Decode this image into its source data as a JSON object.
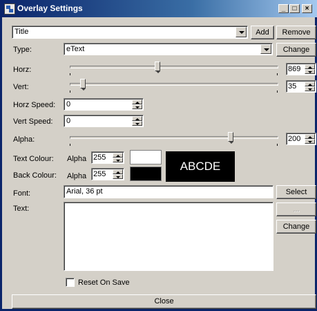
{
  "window": {
    "title": "Overlay Settings"
  },
  "titlebar_buttons": {
    "minimize": "_",
    "maximize": "□",
    "close": "×"
  },
  "overlay_select": {
    "value": "Title"
  },
  "buttons": {
    "add": "Add",
    "remove": "Remove",
    "change_type": "Change",
    "select_font": "Select",
    "browse": "...",
    "change_text": "Change",
    "close": "Close"
  },
  "type": {
    "label": "Type:",
    "value": "eText"
  },
  "horz": {
    "label": "Horz:",
    "value": "869",
    "level_fraction": 0.42
  },
  "vert": {
    "label": "Vert:",
    "value": "35",
    "level_fraction": 0.05
  },
  "horz_speed": {
    "label": "Horz Speed:",
    "value": "0"
  },
  "vert_speed": {
    "label": "Vert Speed:",
    "value": "0"
  },
  "alpha": {
    "label": "Alpha:",
    "value": "200",
    "level_fraction": 0.78
  },
  "text_colour": {
    "label": "Text Colour:",
    "alpha_label": "Alpha",
    "alpha_value": "255",
    "color": "#ffffff"
  },
  "back_colour": {
    "label": "Back Colour:",
    "alpha_label": "Alpha",
    "alpha_value": "255",
    "color": "#000000"
  },
  "preview": {
    "text": "ABCDE"
  },
  "font": {
    "label": "Font:",
    "value": "Arial, 36 pt"
  },
  "text": {
    "label": "Text:",
    "value": ""
  },
  "reset_on_save": {
    "label": "Reset On Save",
    "checked": false
  }
}
